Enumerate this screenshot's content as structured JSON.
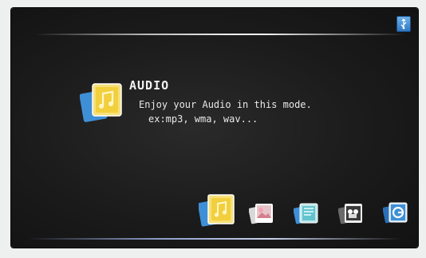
{
  "mode": {
    "title": "AUDIO",
    "description": "Enjoy your Audio in this mode.",
    "example": "ex:mp3, wma, wav..."
  },
  "mode_icons": [
    {
      "name": "audio-mode-icon",
      "selected": true
    },
    {
      "name": "photo-mode-icon",
      "selected": false
    },
    {
      "name": "ebook-mode-icon",
      "selected": false
    },
    {
      "name": "video-mode-icon",
      "selected": false
    },
    {
      "name": "setup-mode-icon",
      "selected": false
    }
  ],
  "status": {
    "usb_icon": "usb-icon"
  },
  "colors": {
    "background": "#1b1b1b",
    "text": "#f2f2f2",
    "audio_yellow": "#f3d64a",
    "usb_blue": "#3f8fd9"
  }
}
